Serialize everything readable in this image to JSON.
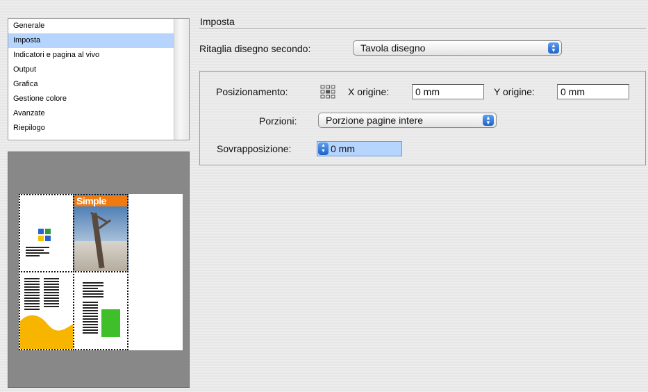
{
  "sidebar": {
    "items": [
      {
        "label": "Generale"
      },
      {
        "label": "Imposta"
      },
      {
        "label": "Indicatori e pagina al vivo"
      },
      {
        "label": "Output"
      },
      {
        "label": "Grafica"
      },
      {
        "label": "Gestione colore"
      },
      {
        "label": "Avanzate"
      },
      {
        "label": "Riepilogo"
      }
    ],
    "selected": "Imposta"
  },
  "preview": {
    "magazine_title": "Simple"
  },
  "section": {
    "title": "Imposta",
    "crop_label": "Ritaglia disegno secondo:",
    "crop_value": "Tavola disegno",
    "positioning_label": "Posizionamento:",
    "x_origin_label": "X origine:",
    "x_origin_value": "0 mm",
    "y_origin_label": "Y origine:",
    "y_origin_value": "0 mm",
    "tiles_label": "Porzioni:",
    "tiles_value": "Porzione pagine intere",
    "overlap_label": "Sovrapposizione:",
    "overlap_value": "0 mm"
  },
  "colors": {
    "selection": "#b5d5ff",
    "popup_arrow": "#2a6fd6",
    "preview_bg": "#888888"
  },
  "icons": [
    "reference-point-icon",
    "popup-arrows-icon",
    "stepper-icon"
  ]
}
